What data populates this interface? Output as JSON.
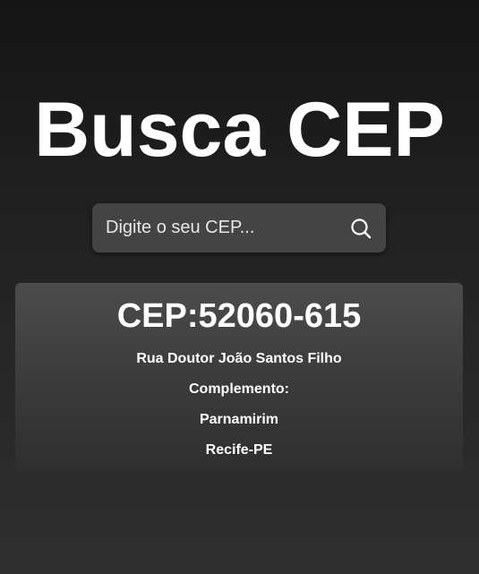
{
  "app": {
    "title": "Busca CEP"
  },
  "search": {
    "placeholder": "Digite o seu CEP...",
    "value": "",
    "button_icon": "search-icon"
  },
  "result": {
    "cep_label": "CEP:",
    "cep_value": "52060-615",
    "cep_display": "CEP:52060-615",
    "street": "Rua Doutor João Santos Filho",
    "complement": "Complemento:",
    "neighborhood": "Parnamirim",
    "city_state": "Recife-PE"
  },
  "colors": {
    "background_top": "#151515",
    "background_bottom": "#2f2f2f",
    "search_box": "#444444",
    "card_top": "#4c4c4c",
    "card_bottom": "#2f2f2f",
    "text": "#ffffff"
  }
}
